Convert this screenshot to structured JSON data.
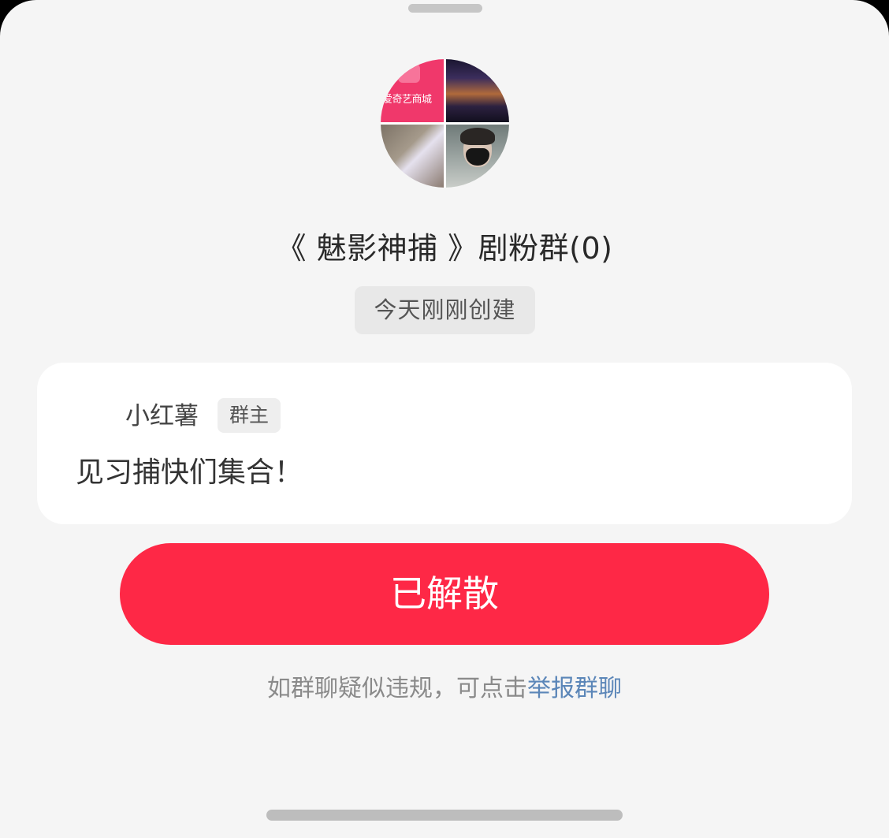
{
  "group": {
    "title": "《 魅影神捕 》剧粉群(0)",
    "created_label": "今天刚刚创建",
    "avatar_tiles": [
      {
        "name": "iqiyi-mall-logo",
        "text": "爱奇艺商城"
      },
      {
        "name": "stage-concert-photo"
      },
      {
        "name": "bag-photo"
      },
      {
        "name": "masked-person-photo"
      }
    ]
  },
  "notice": {
    "owner_name": "小红薯",
    "owner_role": "群主",
    "message": "见习捕快们集合！"
  },
  "status_button": {
    "label": "已解散"
  },
  "report": {
    "prefix": "如群聊疑似违规，可点击",
    "link_label": "举报群聊"
  },
  "colors": {
    "primary_red": "#fe2846",
    "link_blue": "#5b86b8",
    "sheet_bg": "#f5f5f5"
  }
}
